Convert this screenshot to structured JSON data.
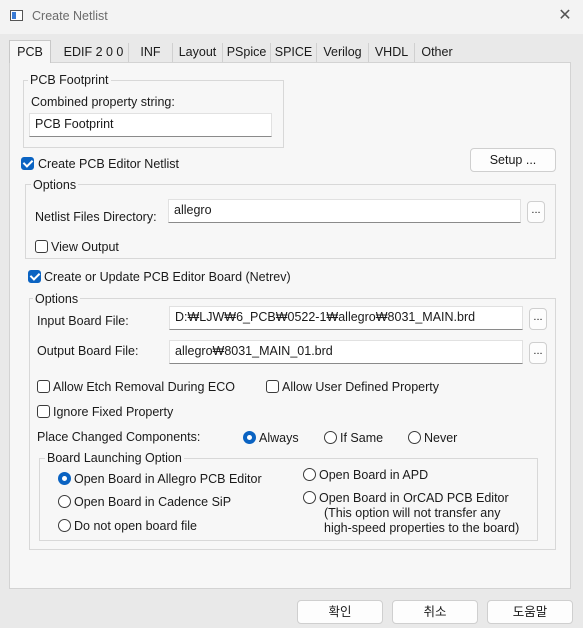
{
  "window": {
    "title": "Create Netlist",
    "close_glyph": "✕"
  },
  "tabs": [
    "PCB",
    "EDIF 2 0 0",
    "INF",
    "Layout",
    "PSpice",
    "SPICE",
    "Verilog",
    "VHDL",
    "Other"
  ],
  "pcb_footprint": {
    "group_label": "PCB Footprint",
    "combined_label": "Combined property string:",
    "value": "PCB Footprint"
  },
  "create_netlist": {
    "label": "Create PCB Editor Netlist",
    "checked": true
  },
  "setup_button": "Setup ...",
  "options1": {
    "group_label": "Options",
    "dir_label": "Netlist Files Directory:",
    "dir_value": "allegro",
    "browse": "...",
    "view_output": {
      "label": "View Output",
      "checked": false
    }
  },
  "create_board": {
    "label": "Create or Update PCB Editor Board (Netrev)",
    "checked": true
  },
  "options2": {
    "group_label": "Options",
    "input_label": "Input Board File:",
    "input_value": "D:₩LJW₩6_PCB₩0522-1₩allegro₩8031_MAIN.brd",
    "output_label": "Output Board File:",
    "output_value": "allegro₩8031_MAIN_01.brd",
    "browse": "...",
    "allow_etch": {
      "label": "Allow Etch Removal During ECO",
      "checked": false
    },
    "allow_user": {
      "label": "Allow User Defined Property",
      "checked": false
    },
    "ignore_fixed": {
      "label": "Ignore Fixed Property",
      "checked": false
    },
    "place_changed_label": "Place Changed Components:",
    "place_options": [
      {
        "label": "Always",
        "selected": true
      },
      {
        "label": "If Same",
        "selected": false
      },
      {
        "label": "Never",
        "selected": false
      }
    ]
  },
  "launching": {
    "group_label": "Board Launching Option",
    "opt_allegro": {
      "label": "Open Board in Allegro PCB Editor",
      "selected": true
    },
    "opt_sip": {
      "label": "Open Board in Cadence SiP",
      "selected": false
    },
    "opt_none": {
      "label": "Do not open board file",
      "selected": false
    },
    "opt_apd": {
      "label": "Open Board in APD",
      "selected": false
    },
    "opt_orcad": {
      "label": "Open Board in OrCAD PCB Editor",
      "selected": false
    },
    "orcad_note_1": "(This option will not transfer any",
    "orcad_note_2": "high-speed properties to the board)"
  },
  "footer": {
    "ok": "확인",
    "cancel": "취소",
    "help": "도움말"
  }
}
